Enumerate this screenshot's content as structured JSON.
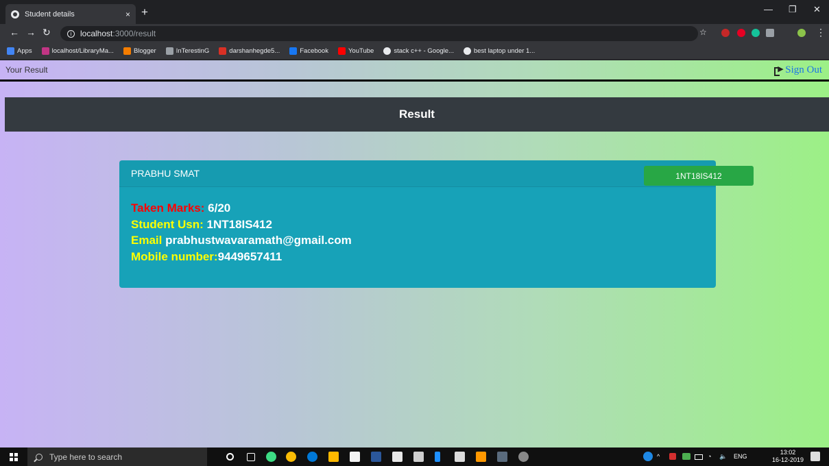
{
  "browser": {
    "tab_title": "Student details",
    "tab_close": "×",
    "new_tab": "+",
    "url_host": "localhost",
    "url_path": ":3000/result",
    "bookmarks": [
      {
        "label": "Apps",
        "color": "#4285f4"
      },
      {
        "label": "localhost/LibraryMa...",
        "color": "#c13584"
      },
      {
        "label": "Blogger",
        "color": "#f57d00"
      },
      {
        "label": "InTerestinG",
        "color": "#9aa0a6"
      },
      {
        "label": "darshanhegde5...",
        "color": "#d93025"
      },
      {
        "label": "Facebook",
        "color": "#1877f2"
      },
      {
        "label": "YouTube",
        "color": "#ff0000"
      },
      {
        "label": "stack c++ - Google...",
        "color": "#e8eaed"
      },
      {
        "label": "best laptop under 1...",
        "color": "#e8eaed"
      }
    ]
  },
  "nav": {
    "brand": "Your Result",
    "sign_out": "Sign Out"
  },
  "header": {
    "title": "Result"
  },
  "student": {
    "name": "PRABHU SMAT",
    "usn_badge": "1NT18IS412",
    "marks_label": "Taken Marks:",
    "marks_value": "6/20",
    "usn_label": "Student Usn:",
    "usn_value": "1NT18IS412",
    "email_label": "Email",
    "email_value": "prabhustwavaramath@gmail.com",
    "mobile_label": "Mobile number:",
    "mobile_value": "9449657411"
  },
  "taskbar": {
    "search_placeholder": "Type here to search",
    "language": "ENG",
    "time": "13:02",
    "date": "16-12-2019"
  }
}
